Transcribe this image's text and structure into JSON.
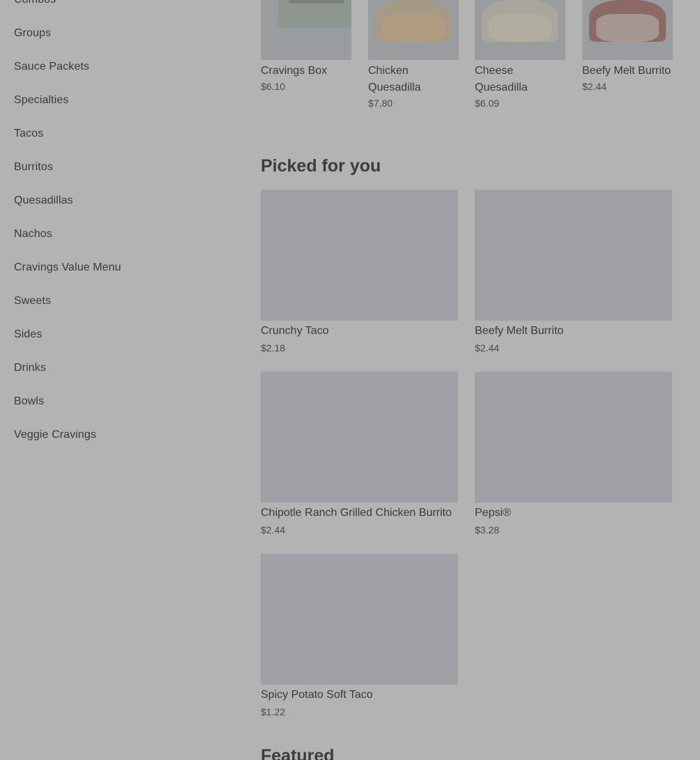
{
  "sidebar": {
    "items": [
      {
        "label": "Combos"
      },
      {
        "label": "Groups"
      },
      {
        "label": "Sauce Packets"
      },
      {
        "label": "Specialties"
      },
      {
        "label": "Tacos"
      },
      {
        "label": "Burritos"
      },
      {
        "label": "Quesadillas"
      },
      {
        "label": "Nachos"
      },
      {
        "label": "Cravings Value Menu"
      },
      {
        "label": "Sweets"
      },
      {
        "label": "Sides"
      },
      {
        "label": "Drinks"
      },
      {
        "label": "Bowls"
      },
      {
        "label": "Veggie Cravings"
      }
    ]
  },
  "top_items": [
    {
      "name": "Cravings Box",
      "price": "$6.10"
    },
    {
      "name": "Chicken Quesadilla",
      "price": "$7.80"
    },
    {
      "name": "Cheese Quesadilla",
      "price": "$6.09"
    },
    {
      "name": "Beefy Melt Burrito",
      "price": "$2.44"
    }
  ],
  "picked": {
    "title": "Picked for you",
    "items": [
      {
        "name": "Crunchy Taco",
        "price": "$2.18"
      },
      {
        "name": "Beefy Melt Burrito",
        "price": "$2.44"
      },
      {
        "name": "Chipotle Ranch Grilled Chicken Burrito",
        "price": "$2.44"
      },
      {
        "name": "Pepsi®",
        "price": "$3.28"
      },
      {
        "name": "Spicy Potato Soft Taco",
        "price": "$1.22"
      }
    ]
  },
  "featured": {
    "title": "Featured"
  }
}
